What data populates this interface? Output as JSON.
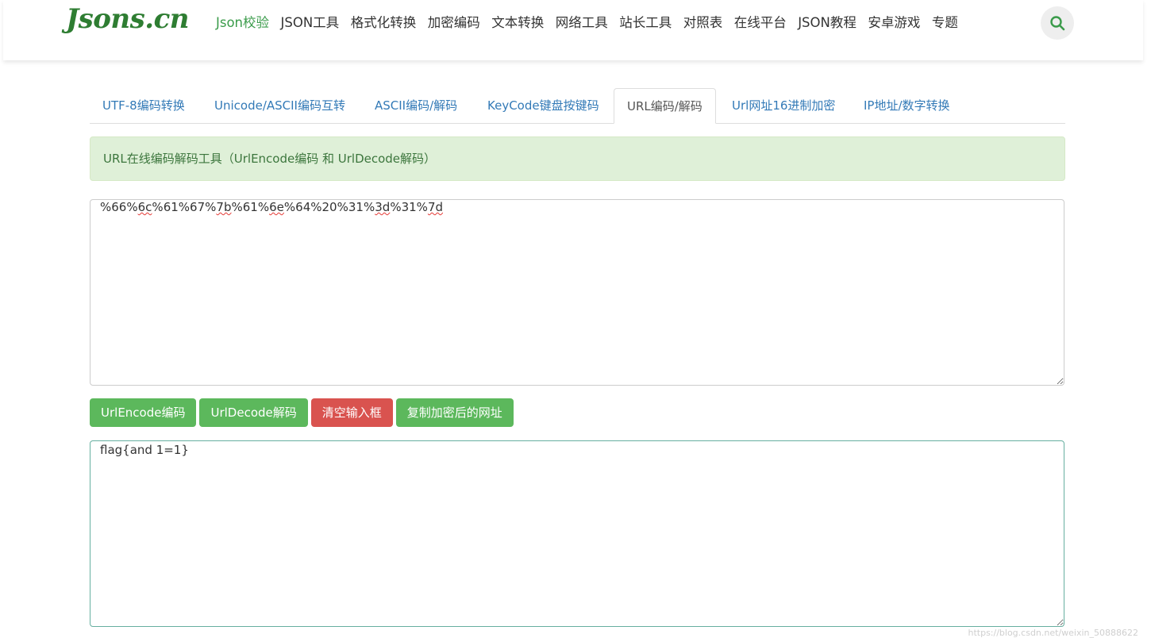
{
  "logo": "Jsons.cn",
  "nav": [
    "Json校验",
    "JSON工具",
    "格式化转换",
    "加密编码",
    "文本转换",
    "网络工具",
    "站长工具",
    "对照表",
    "在线平台",
    "JSON教程",
    "安卓游戏",
    "专题"
  ],
  "nav_active": 0,
  "search_icon": "search-icon",
  "tabs": [
    "UTF-8编码转换",
    "Unicode/ASCII编码互转",
    "ASCII编码/解码",
    "KeyCode键盘按键码",
    "URL编码/解码",
    "Url网址16进制加密",
    "IP地址/数字转换"
  ],
  "tab_active": 4,
  "alert": "URL在线编码解码工具（UrlEncode编码 和 UrlDecode解码）",
  "input_value": "%66%6c%61%67%7b%61%6e%64%20%31%3d%31%7d",
  "buttons": {
    "encode": "UrlEncode编码",
    "decode": "UrlDecode解码",
    "clear": "清空输入框",
    "copy": "复制加密后的网址"
  },
  "output_value": "flag{and 1=1}",
  "watermark": "https://blog.csdn.net/weixin_50888622",
  "colors": {
    "accent_green": "#5cb85c",
    "danger_red": "#d9534f",
    "link_blue": "#337ab7",
    "alert_bg": "#dff0d8",
    "logo_green": "#2e7d32"
  }
}
